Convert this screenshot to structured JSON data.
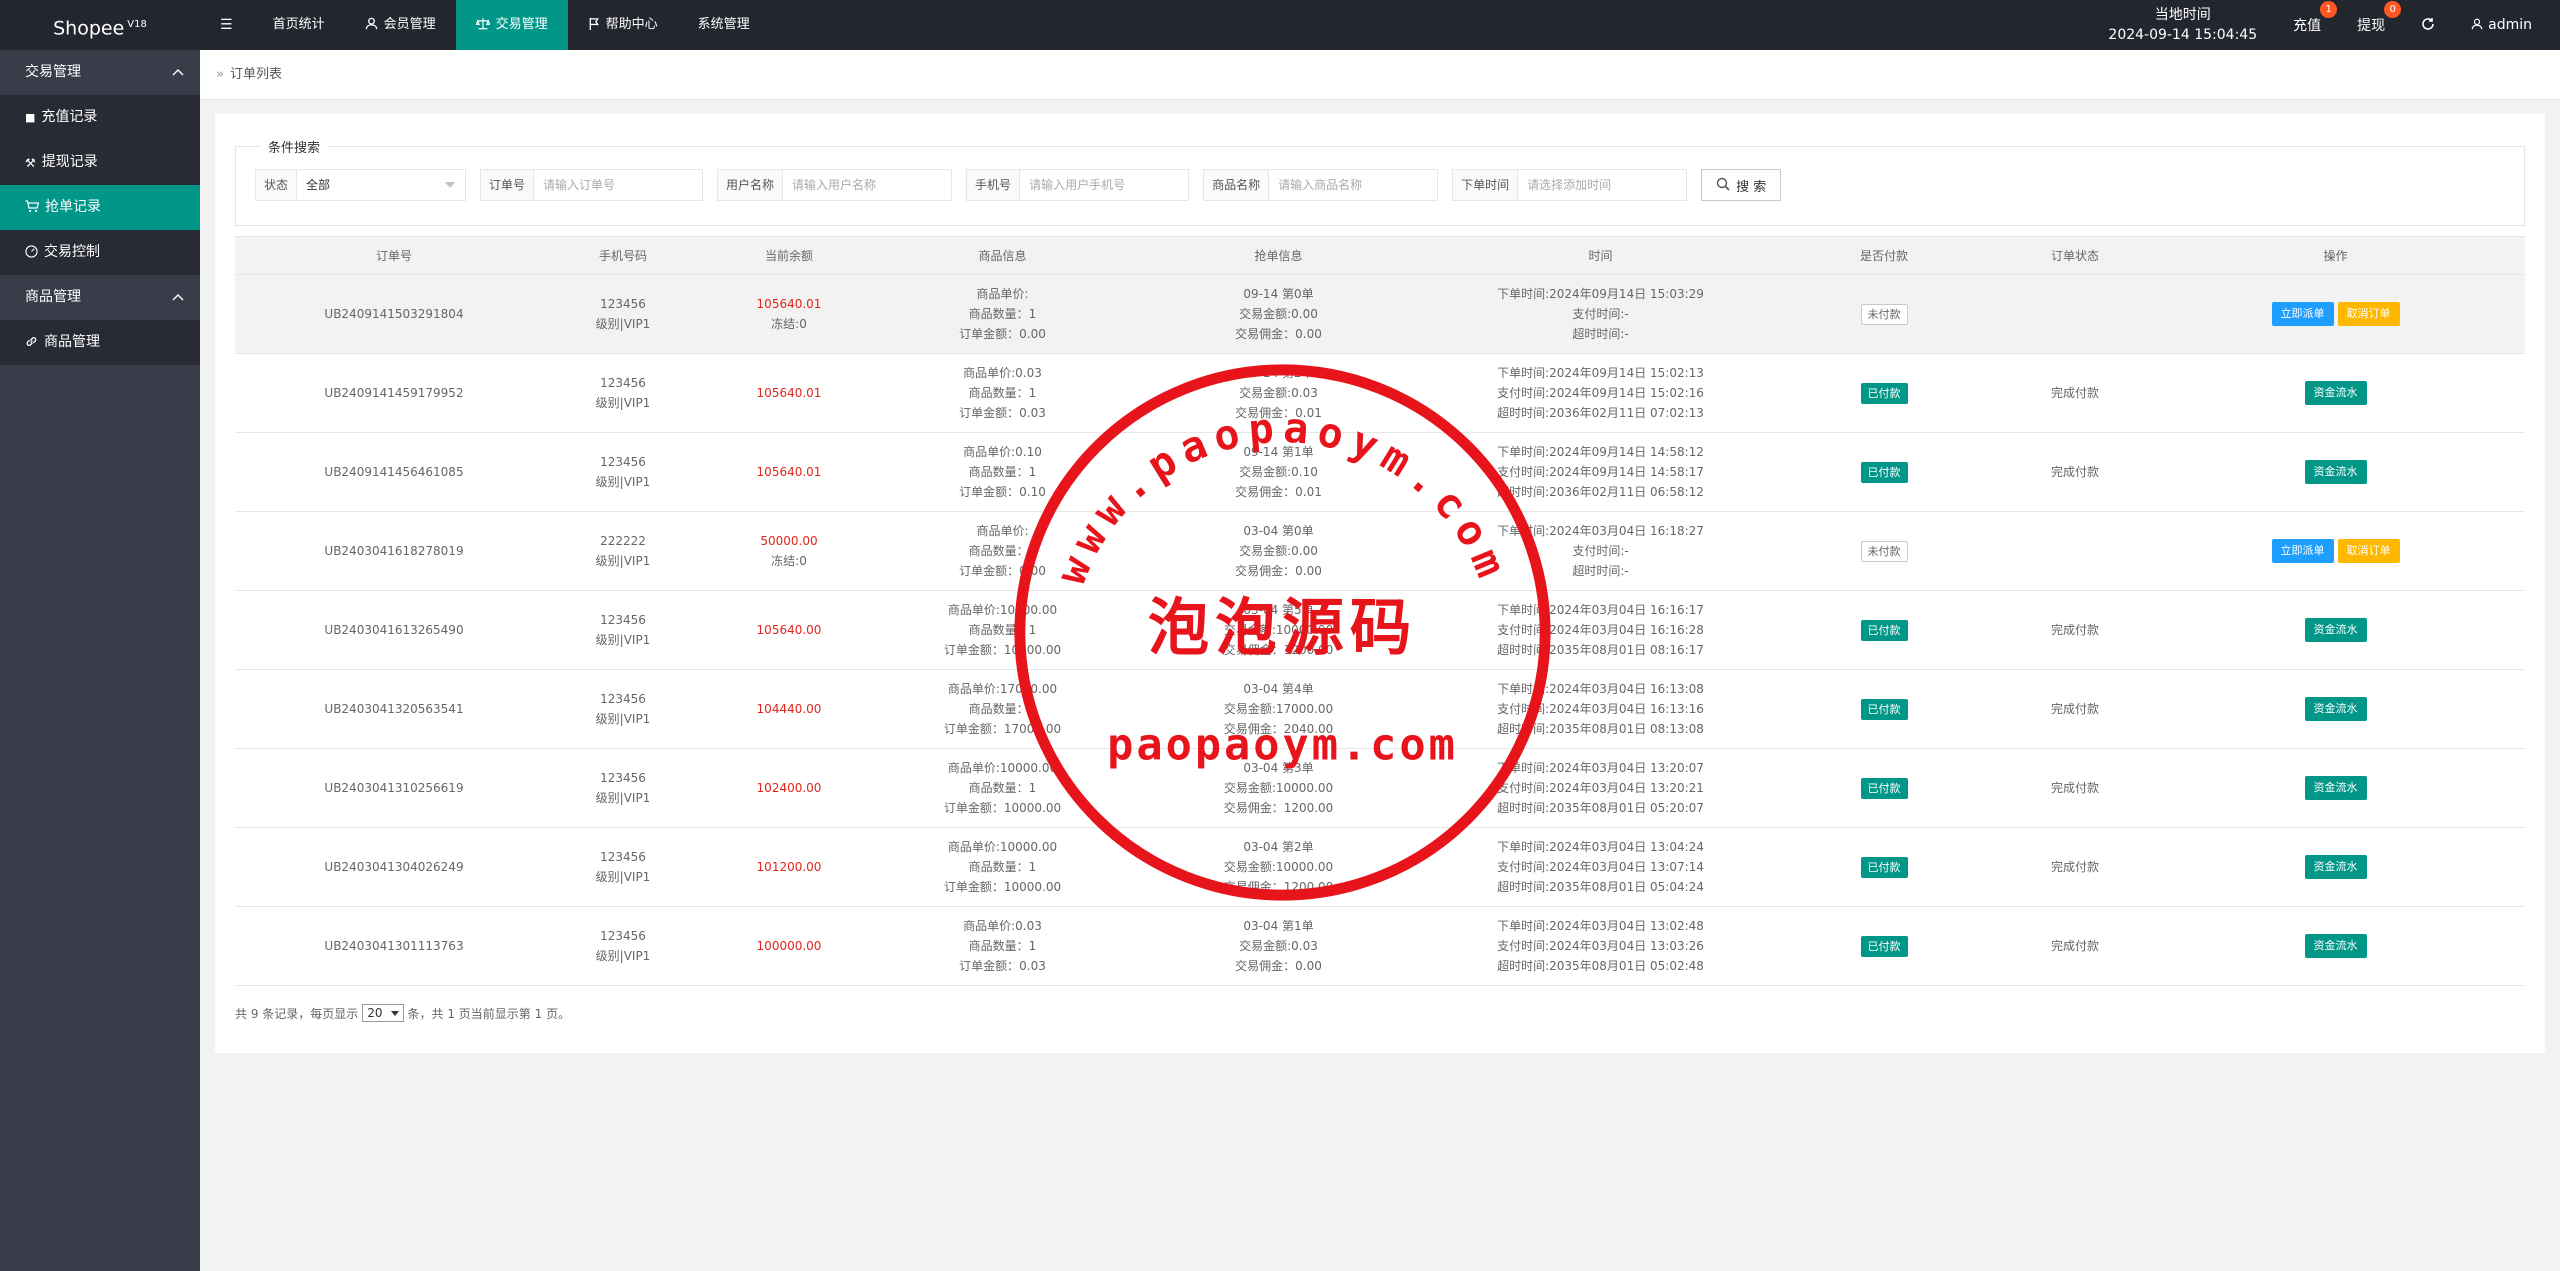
{
  "brand": {
    "name": "Shopee",
    "version": "V18"
  },
  "topnav": {
    "menu_icon": "hamburger-icon",
    "items": [
      {
        "label": "首页统计"
      },
      {
        "label": "会员管理",
        "icon": "user-icon"
      },
      {
        "label": "交易管理",
        "icon": "scale-icon"
      },
      {
        "label": "帮助中心",
        "icon": "flag-icon"
      },
      {
        "label": "系统管理"
      }
    ]
  },
  "topright": {
    "time_label": "当地时间",
    "time_value": "2024-09-14 15:04:45",
    "recharge_label": "充值",
    "recharge_badge": "1",
    "withdraw_label": "提现",
    "withdraw_badge": "0",
    "refresh_icon": "refresh-icon",
    "user": "admin"
  },
  "sidebar": {
    "groups": [
      {
        "label": "交易管理",
        "items": [
          "充值记录",
          "提现记录",
          "抢单记录",
          "交易控制"
        ]
      },
      {
        "label": "商品管理",
        "items": [
          "商品管理"
        ]
      }
    ]
  },
  "breadcrumb": {
    "current": "订单列表"
  },
  "search": {
    "legend": "条件搜索",
    "status_label": "状态",
    "status_value": "全部",
    "order_label": "订单号",
    "order_placeholder": "请输入订单号",
    "username_label": "用户名称",
    "username_placeholder": "请输入用户名称",
    "phone_label": "手机号",
    "phone_placeholder": "请输入用户手机号",
    "product_label": "商品名称",
    "product_placeholder": "请输入商品名称",
    "time_label": "下单时间",
    "time_placeholder": "请选择添加时间",
    "button": "搜 索"
  },
  "table": {
    "headers": [
      "订单号",
      "手机号码",
      "当前余额",
      "商品信息",
      "抢单信息",
      "时间",
      "是否付款",
      "订单状态",
      "操作"
    ],
    "rows": [
      {
        "order": "UB2409141503291804",
        "phone": "123456",
        "level": "级别|VIP1",
        "balance": "105640.01",
        "frozen": "冻结:0",
        "g1": "商品单价:",
        "g2": "商品数量：1",
        "g3": "订单金额：0.00",
        "q1": "09-14 第0单",
        "q2": "交易金额:0.00",
        "q3": "交易佣金：0.00",
        "t1": "下单时间:2024年09月14日 15:03:29",
        "t2": "支付时间:-",
        "t3": "超时时间:-",
        "pay": "未付款",
        "status": "",
        "a1": "立即派单",
        "a2": "取消订单"
      },
      {
        "order": "UB2409141459179952",
        "phone": "123456",
        "level": "级别|VIP1",
        "balance": "105640.01",
        "frozen": "",
        "g1": "商品单价:0.03",
        "g2": "商品数量：1",
        "g3": "订单金额：0.03",
        "q1": "09-14 第2单",
        "q2": "交易金额:0.03",
        "q3": "交易佣金：0.01",
        "t1": "下单时间:2024年09月14日 15:02:13",
        "t2": "支付时间:2024年09月14日 15:02:16",
        "t3": "超时时间:2036年02月11日 07:02:13",
        "pay": "已付款",
        "status": "完成付款",
        "a1": "资金流水",
        "a2": ""
      },
      {
        "order": "UB2409141456461085",
        "phone": "123456",
        "level": "级别|VIP1",
        "balance": "105640.01",
        "frozen": "",
        "g1": "商品单价:0.10",
        "g2": "商品数量：1",
        "g3": "订单金额：0.10",
        "q1": "09-14 第1单",
        "q2": "交易金额:0.10",
        "q3": "交易佣金：0.01",
        "t1": "下单时间:2024年09月14日 14:58:12",
        "t2": "支付时间:2024年09月14日 14:58:17",
        "t3": "超时时间:2036年02月11日 06:58:12",
        "pay": "已付款",
        "status": "完成付款",
        "a1": "资金流水",
        "a2": ""
      },
      {
        "order": "UB2403041618278019",
        "phone": "222222",
        "level": "级别|VIP1",
        "balance": "50000.00",
        "frozen": "冻结:0",
        "g1": "商品单价:",
        "g2": "商品数量：1",
        "g3": "订单金额：0.00",
        "q1": "03-04 第0单",
        "q2": "交易金额:0.00",
        "q3": "交易佣金：0.00",
        "t1": "下单时间:2024年03月04日 16:18:27",
        "t2": "支付时间:-",
        "t3": "超时时间:-",
        "pay": "未付款",
        "status": "",
        "a1": "立即派单",
        "a2": "取消订单"
      },
      {
        "order": "UB2403041613265490",
        "phone": "123456",
        "level": "级别|VIP1",
        "balance": "105640.00",
        "frozen": "",
        "g1": "商品单价:10000.00",
        "g2": "商品数量：1",
        "g3": "订单金额：10000.00",
        "q1": "03-04 第5单",
        "q2": "交易金额:10000.00",
        "q3": "交易佣金：1200.00",
        "t1": "下单时间:2024年03月04日 16:16:17",
        "t2": "支付时间:2024年03月04日 16:16:28",
        "t3": "超时时间:2035年08月01日 08:16:17",
        "pay": "已付款",
        "status": "完成付款",
        "a1": "资金流水",
        "a2": ""
      },
      {
        "order": "UB2403041320563541",
        "phone": "123456",
        "level": "级别|VIP1",
        "balance": "104440.00",
        "frozen": "",
        "g1": "商品单价:17000.00",
        "g2": "商品数量：1",
        "g3": "订单金额：17000.00",
        "q1": "03-04 第4单",
        "q2": "交易金额:17000.00",
        "q3": "交易佣金：2040.00",
        "t1": "下单时间:2024年03月04日 16:13:08",
        "t2": "支付时间:2024年03月04日 16:13:16",
        "t3": "超时时间:2035年08月01日 08:13:08",
        "pay": "已付款",
        "status": "完成付款",
        "a1": "资金流水",
        "a2": ""
      },
      {
        "order": "UB2403041310256619",
        "phone": "123456",
        "level": "级别|VIP1",
        "balance": "102400.00",
        "frozen": "",
        "g1": "商品单价:10000.00",
        "g2": "商品数量：1",
        "g3": "订单金额：10000.00",
        "q1": "03-04 第3单",
        "q2": "交易金额:10000.00",
        "q3": "交易佣金：1200.00",
        "t1": "下单时间:2024年03月04日 13:20:07",
        "t2": "支付时间:2024年03月04日 13:20:21",
        "t3": "超时时间:2035年08月01日 05:20:07",
        "pay": "已付款",
        "status": "完成付款",
        "a1": "资金流水",
        "a2": ""
      },
      {
        "order": "UB2403041304026249",
        "phone": "123456",
        "level": "级别|VIP1",
        "balance": "101200.00",
        "frozen": "",
        "g1": "商品单价:10000.00",
        "g2": "商品数量：1",
        "g3": "订单金额：10000.00",
        "q1": "03-04 第2单",
        "q2": "交易金额:10000.00",
        "q3": "交易佣金：1200.00",
        "t1": "下单时间:2024年03月04日 13:04:24",
        "t2": "支付时间:2024年03月04日 13:07:14",
        "t3": "超时时间:2035年08月01日 05:04:24",
        "pay": "已付款",
        "status": "完成付款",
        "a1": "资金流水",
        "a2": ""
      },
      {
        "order": "UB2403041301113763",
        "phone": "123456",
        "level": "级别|VIP1",
        "balance": "100000.00",
        "frozen": "",
        "g1": "商品单价:0.03",
        "g2": "商品数量：1",
        "g3": "订单金额：0.03",
        "q1": "03-04 第1单",
        "q2": "交易金额:0.03",
        "q3": "交易佣金：0.00",
        "t1": "下单时间:2024年03月04日 13:02:48",
        "t2": "支付时间:2024年03月04日 13:03:26",
        "t3": "超时时间:2035年08月01日 05:02:48",
        "pay": "已付款",
        "status": "完成付款",
        "a1": "资金流水",
        "a2": ""
      }
    ]
  },
  "pager": {
    "prefix": "共 9 条记录，每页显示",
    "per_page": "20",
    "suffix": "条，共 1 页当前显示第 1 页。"
  },
  "watermark": {
    "arc_text": "www.paopaoym.com",
    "center_text": "泡泡源码",
    "bottom_text": "paopaoym.com",
    "color": "#e8141b"
  },
  "colors": {
    "accent": "#009688",
    "topbar": "#23262e",
    "sidebar": "#393d49",
    "danger": "#e1251b",
    "primary": "#1e9fff",
    "warn": "#ffb800"
  }
}
